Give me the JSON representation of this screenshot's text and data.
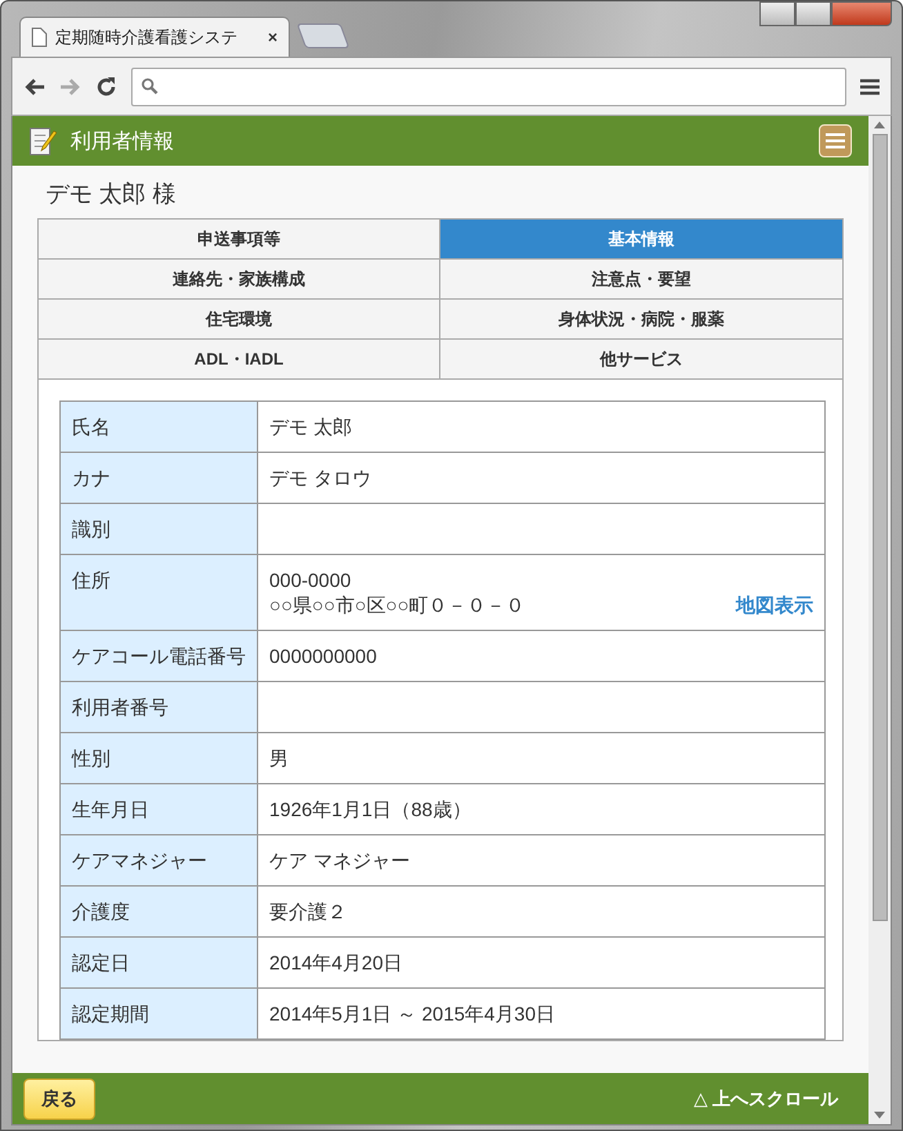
{
  "browser": {
    "tab_title": "定期随時介護看護システ",
    "tab_close": "×"
  },
  "header": {
    "title": "利用者情報"
  },
  "user_name": "デモ 太郎 様",
  "tabs": [
    {
      "label": "申送事項等",
      "selected": false
    },
    {
      "label": "基本情報",
      "selected": true
    },
    {
      "label": "連絡先・家族構成",
      "selected": false
    },
    {
      "label": "注意点・要望",
      "selected": false
    },
    {
      "label": "住宅環境",
      "selected": false
    },
    {
      "label": "身体状況・病院・服薬",
      "selected": false
    },
    {
      "label": "ADL・IADL",
      "selected": false
    },
    {
      "label": "他サービス",
      "selected": false
    }
  ],
  "rows": [
    {
      "label": "氏名",
      "lines": [
        "デモ 太郎"
      ]
    },
    {
      "label": "カナ",
      "lines": [
        "デモ タロウ"
      ]
    },
    {
      "label": "識別",
      "lines": []
    },
    {
      "label": "住所",
      "lines": [
        "000-0000",
        "○○県○○市○区○○町０－０－０"
      ],
      "link": "地図表示"
    },
    {
      "label": "ケアコール電話番号",
      "lines": [
        "0000000000"
      ]
    },
    {
      "label": "利用者番号",
      "lines": []
    },
    {
      "label": "性別",
      "lines": [
        "男"
      ]
    },
    {
      "label": "生年月日",
      "lines": [
        "1926年1月1日（88歳）"
      ]
    },
    {
      "label": "ケアマネジャー",
      "lines": [
        "ケア マネジャー"
      ]
    },
    {
      "label": "介護度",
      "lines": [
        "要介護２"
      ]
    },
    {
      "label": "認定日",
      "lines": [
        "2014年4月20日"
      ]
    },
    {
      "label": "認定期間",
      "lines": [
        "2014年5月1日 ～ 2015年4月30日"
      ]
    }
  ],
  "footer": {
    "back_button": "戻る",
    "scroll_top": "△ 上へスクロール"
  }
}
